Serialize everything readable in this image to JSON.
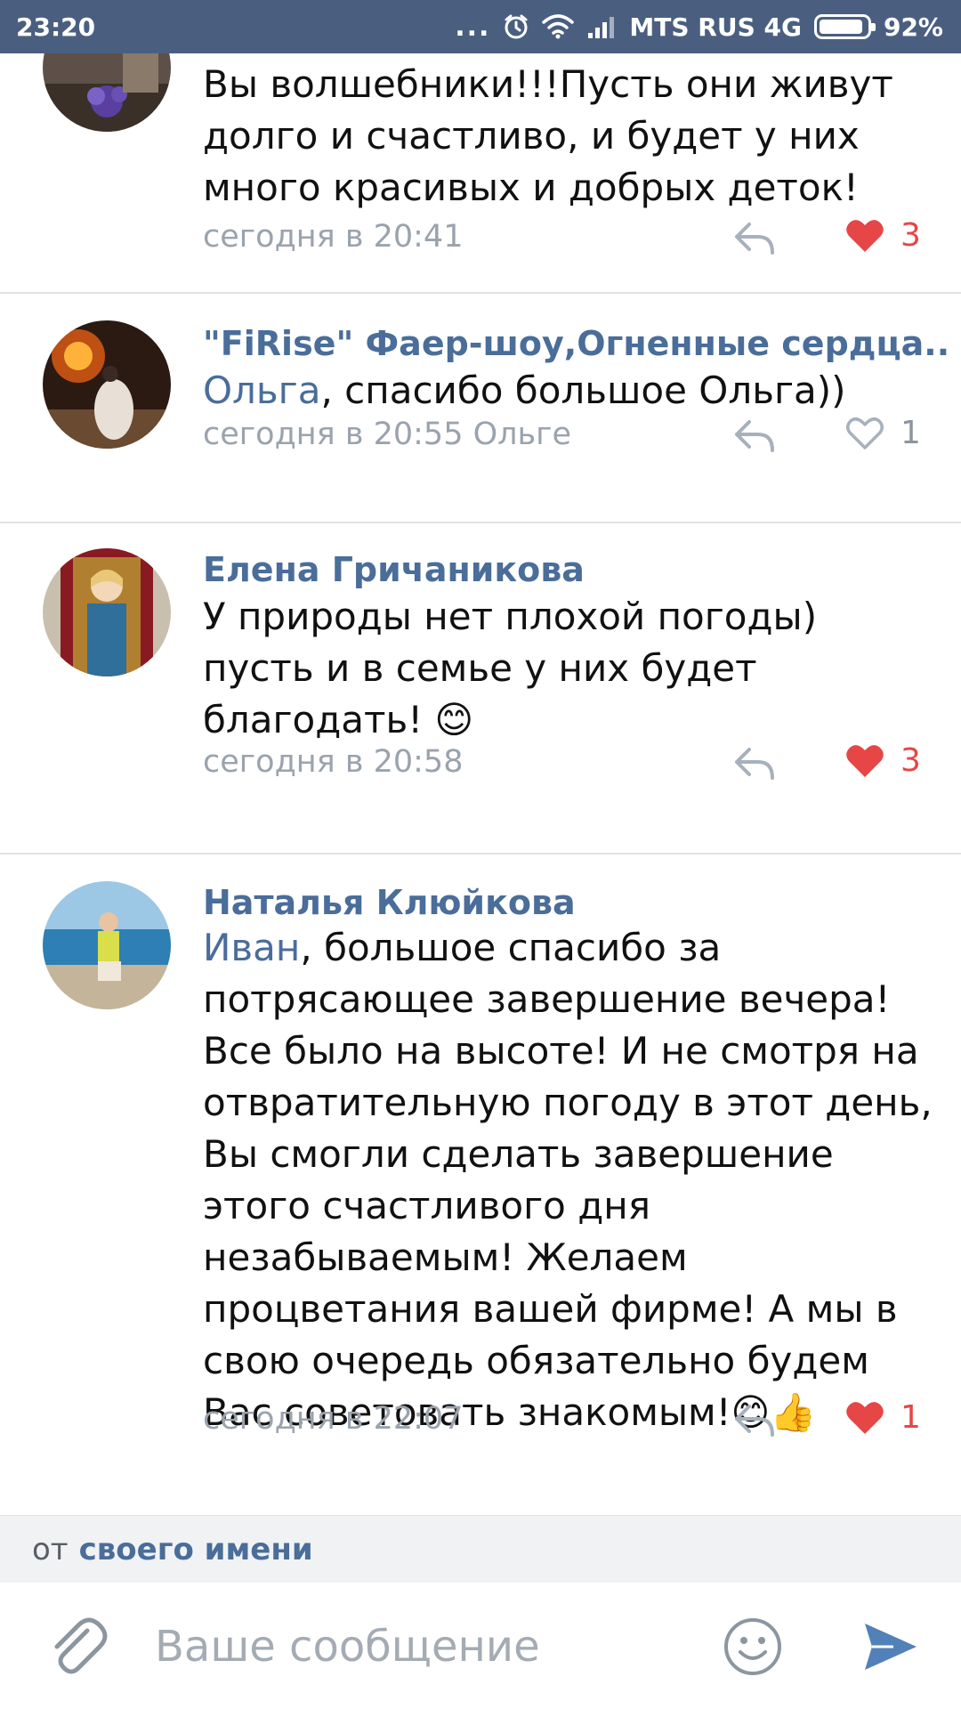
{
  "status_bar": {
    "time": "23:20",
    "dots": "...",
    "carrier": "MTS RUS 4G",
    "battery": "92%",
    "battery_level": 0.92
  },
  "colors": {
    "accent": "#4a6d9a",
    "like_red": "#e64646",
    "muted": "#9aa3ad",
    "status_bar": "#4a5f80"
  },
  "comments": [
    {
      "author": "",
      "mention": "",
      "text": "Вы волшебники!!!Пусть они живут долго и счастливо, и будет у них много красивых и добрых деток!",
      "time": "сегодня в 20:41",
      "likes": "3",
      "liked": true
    },
    {
      "author": "\"FiRise\" Фаер-шоу,Огненные сердца..",
      "mention": "Ольга",
      "text": ", спасибо большое Ольга))",
      "time": "сегодня в 20:55 Ольге",
      "likes": "1",
      "liked": false
    },
    {
      "author": "Елена Гричаникова",
      "mention": "",
      "text": "У природы нет плохой погоды) пусть и в семье у них будет благодать! 😊",
      "time": "сегодня в 20:58",
      "likes": "3",
      "liked": true
    },
    {
      "author": "Наталья Клюйкова",
      "mention": "Иван",
      "text": ", большое спасибо за потрясающее завершение вечера! Все было на высоте! И не смотря на отвратительную погоду в этот день, Вы смогли сделать завершение этого счастливого дня незабываемым! Желаем процветания вашей фирме! А мы в свою очередь обязательно будем Вас советовать знакомым!😊👍",
      "time": "сегодня в 22:07",
      "likes": "1",
      "liked": true
    }
  ],
  "sender": {
    "prefix": "от",
    "link": "своего имени"
  },
  "compose": {
    "placeholder": "Ваше сообщение",
    "value": ""
  }
}
